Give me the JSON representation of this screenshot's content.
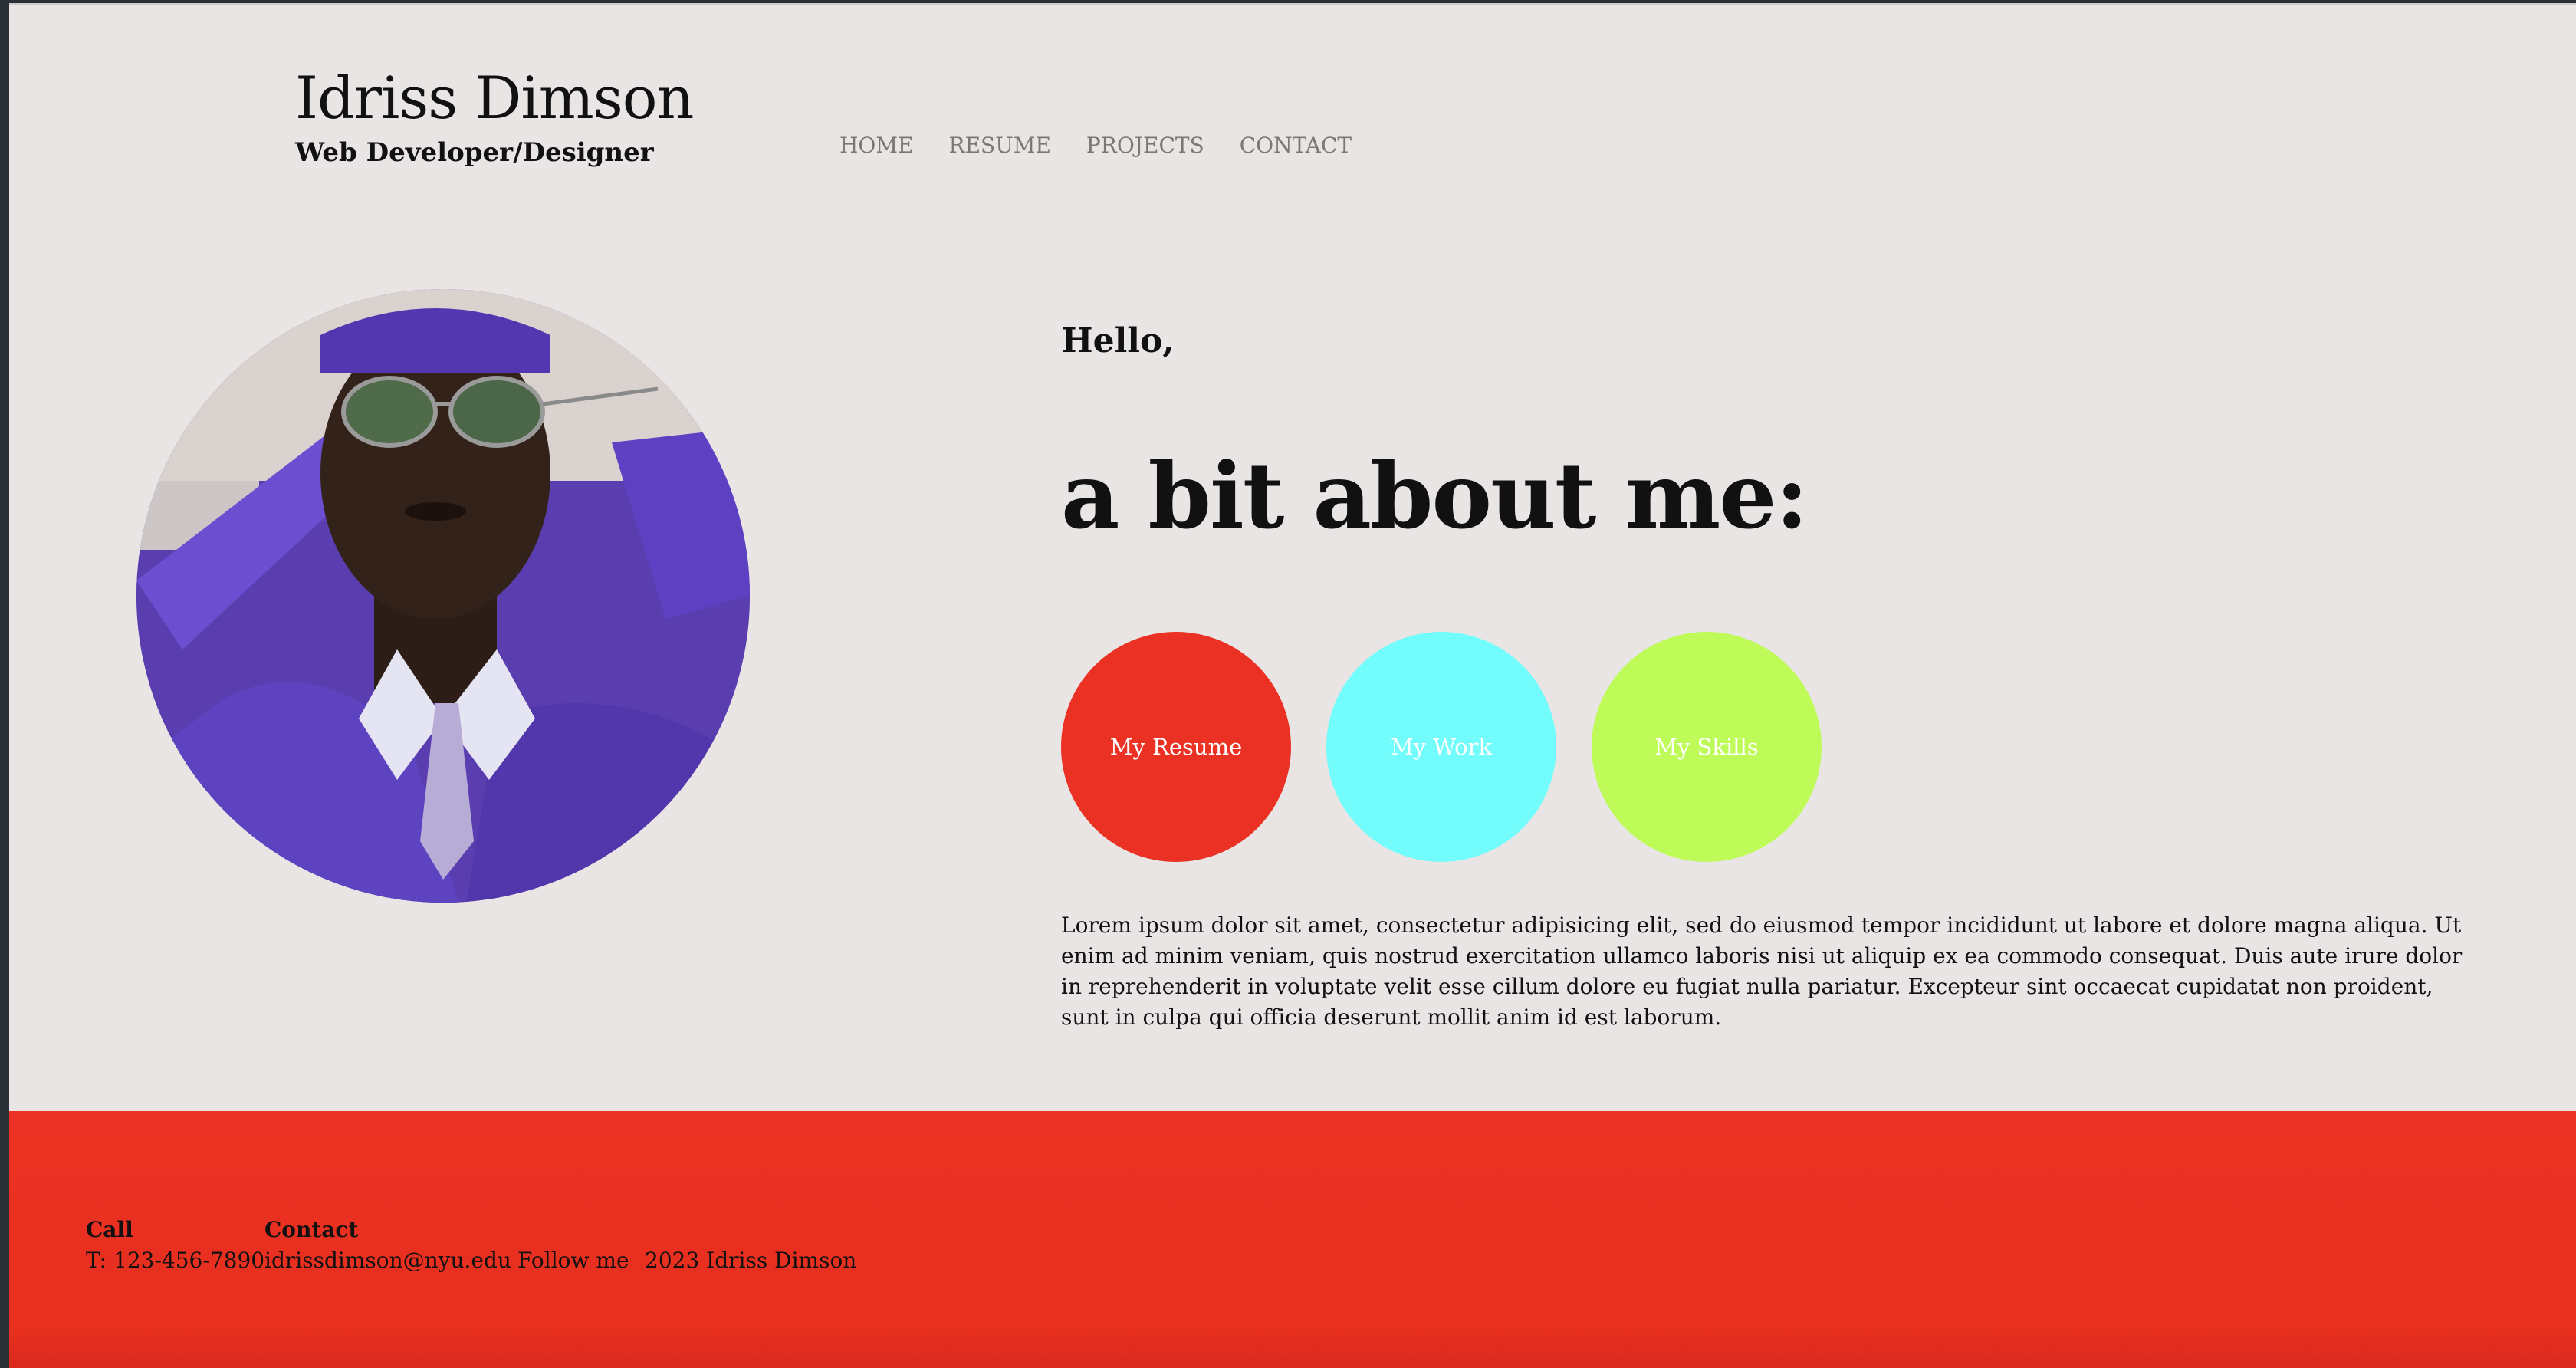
{
  "header": {
    "name": "Idriss Dimson",
    "subtitle": "Web Developer/Designer"
  },
  "nav": [
    "HOME",
    "RESUME",
    "PROJECTS",
    "CONTACT"
  ],
  "intro": {
    "greeting": "Hello,",
    "heading": "a bit about me:"
  },
  "buttons": [
    {
      "label": "My Resume",
      "color": "#ea3123"
    },
    {
      "label": "My Work",
      "color": "#72fcfb"
    },
    {
      "label": "My Skills",
      "color": "#befa58"
    }
  ],
  "body_text": "Lorem ipsum dolor sit amet, consectetur adipisicing elit, sed do eiusmod tempor incididunt ut labore et dolore magna aliqua. Ut enim ad minim veniam, quis nostrud exercitation ullamco laboris nisi ut aliquip ex ea commodo consequat. Duis aute irure dolor in reprehenderit in voluptate velit esse cillum dolore eu fugiat nulla pariatur. Excepteur sint occaecat cupidatat non proident, sunt in culpa qui officia deserunt mollit anim id est laborum.",
  "footer": {
    "call_label": "Call",
    "call_value": "T: 123-456-7890",
    "contact_label": "Contact",
    "contact_value": "idrissdimson@nyu.edu",
    "follow": "Follow me",
    "copyright": "2023 Idriss Dimson",
    "color": "#ea3123"
  },
  "colors": {
    "background": "#e9e5e4",
    "nav_text": "#7c7777"
  }
}
